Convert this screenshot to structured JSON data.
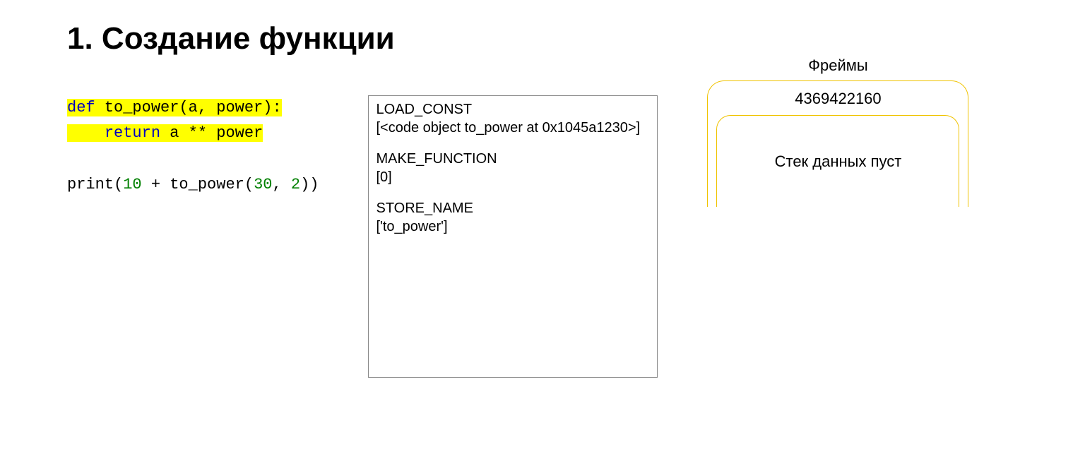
{
  "title": "1. Создание функции",
  "code": {
    "line1": {
      "def": "def",
      "name": " to_power",
      "params": "(a, power)",
      "colon": ":"
    },
    "line2": {
      "ret": "return",
      "rest": " a ** power"
    },
    "line3": {
      "p1": "print(",
      "n1": "10",
      "p2": " + to_power(",
      "n2": "30",
      "p3": ", ",
      "n3": "2",
      "p4": "))"
    }
  },
  "bytecode": {
    "op1": "LOAD_CONST",
    "arg1": "[<code object to_power at 0x1045a1230>]",
    "op2": "MAKE_FUNCTION",
    "arg2": "[0]",
    "op3": "STORE_NAME",
    "arg3": "['to_power']"
  },
  "frames": {
    "label": "Фреймы",
    "id": "4369422160",
    "empty": "Стек данных пуст"
  }
}
